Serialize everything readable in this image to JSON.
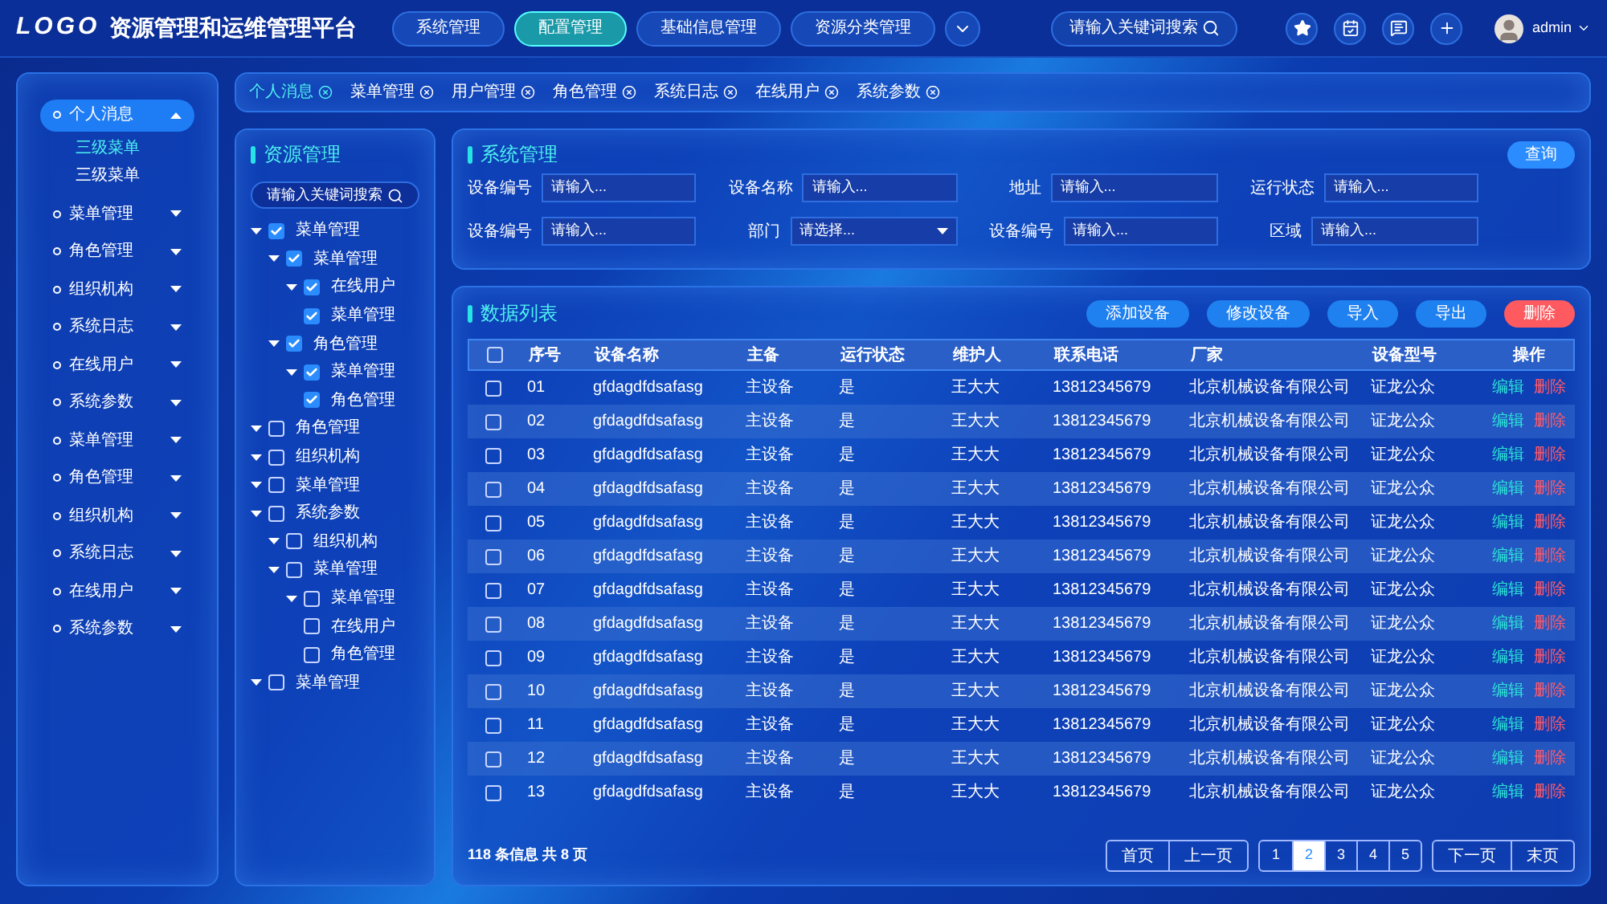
{
  "header": {
    "logo": "LOGO",
    "title": "资源管理和运维管理平台",
    "nav": [
      {
        "label": "系统管理",
        "selected": false
      },
      {
        "label": "配置管理",
        "selected": true
      },
      {
        "label": "基础信息管理",
        "selected": false
      },
      {
        "label": "资源分类管理",
        "selected": false
      }
    ],
    "search": {
      "placeholder": "请输入关键词搜索"
    },
    "user": {
      "name": "admin"
    }
  },
  "tabs": [
    {
      "label": "个人消息",
      "selected": true
    },
    {
      "label": "菜单管理",
      "selected": false
    },
    {
      "label": "用户管理",
      "selected": false
    },
    {
      "label": "角色管理",
      "selected": false
    },
    {
      "label": "系统日志",
      "selected": false
    },
    {
      "label": "在线用户",
      "selected": false
    },
    {
      "label": "系统参数",
      "selected": false
    }
  ],
  "sidebar": {
    "items": [
      {
        "label": "个人消息",
        "selected": true,
        "expanded": true,
        "children": [
          {
            "label": "三级菜单",
            "selected": true
          },
          {
            "label": "三级菜单",
            "selected": false
          }
        ]
      },
      {
        "label": "菜单管理",
        "selected": false,
        "expanded": false
      },
      {
        "label": "角色管理",
        "selected": false,
        "expanded": false
      },
      {
        "label": "组织机构",
        "selected": false,
        "expanded": false
      },
      {
        "label": "系统日志",
        "selected": false,
        "expanded": false
      },
      {
        "label": "在线用户",
        "selected": false,
        "expanded": false
      },
      {
        "label": "系统参数",
        "selected": false,
        "expanded": false
      },
      {
        "label": "菜单管理",
        "selected": false,
        "expanded": false
      },
      {
        "label": "角色管理",
        "selected": false,
        "expanded": false
      },
      {
        "label": "组织机构",
        "selected": false,
        "expanded": false
      },
      {
        "label": "系统日志",
        "selected": false,
        "expanded": false
      },
      {
        "label": "在线用户",
        "selected": false,
        "expanded": false
      },
      {
        "label": "系统参数",
        "selected": false,
        "expanded": false
      }
    ]
  },
  "tree": {
    "title": "资源管理",
    "search": {
      "placeholder": "请输入关键词搜索"
    },
    "nodes": [
      {
        "label": "菜单管理",
        "kind": "branch",
        "checked": true,
        "children": [
          {
            "label": "菜单管理",
            "kind": "branch",
            "checked": true,
            "children": [
              {
                "label": "在线用户",
                "kind": "branch",
                "checked": true
              },
              {
                "label": "菜单管理",
                "kind": "leaf",
                "checked": true
              }
            ]
          },
          {
            "label": "角色管理",
            "kind": "branch",
            "checked": true,
            "children": [
              {
                "label": "菜单管理",
                "kind": "branch",
                "checked": true
              },
              {
                "label": "角色管理",
                "kind": "leaf",
                "checked": true
              }
            ]
          }
        ]
      },
      {
        "label": "角色管理",
        "kind": "branch",
        "checked": false
      },
      {
        "label": "组织机构",
        "kind": "branch",
        "checked": false
      },
      {
        "label": "菜单管理",
        "kind": "branch",
        "checked": false
      },
      {
        "label": "系统参数",
        "kind": "branch",
        "checked": false,
        "children": [
          {
            "label": "组织机构",
            "kind": "branch",
            "checked": false
          },
          {
            "label": "菜单管理",
            "kind": "branch",
            "checked": false,
            "children": [
              {
                "label": "菜单管理",
                "kind": "branch",
                "checked": false
              },
              {
                "label": "在线用户",
                "kind": "leaf",
                "checked": false
              },
              {
                "label": "角色管理",
                "kind": "leaf",
                "checked": false
              }
            ]
          }
        ]
      },
      {
        "label": "菜单管理",
        "kind": "branch",
        "checked": false
      }
    ]
  },
  "filters": {
    "title": "系统管理",
    "query_button": "查询",
    "rows": [
      [
        {
          "label": "设备编号",
          "kind": "input",
          "placeholder": "请输入..."
        },
        {
          "label": "设备名称",
          "kind": "input",
          "placeholder": "请输入..."
        },
        {
          "label": "地址",
          "kind": "input",
          "placeholder": "请输入..."
        },
        {
          "label": "运行状态",
          "kind": "input",
          "placeholder": "请输入..."
        }
      ],
      [
        {
          "label": "设备编号",
          "kind": "input",
          "placeholder": "请输入..."
        },
        {
          "label": "部门",
          "kind": "select",
          "placeholder": "请选择..."
        },
        {
          "label": "设备编号",
          "kind": "input",
          "placeholder": "请输入..."
        },
        {
          "label": "区域",
          "kind": "input",
          "placeholder": "请输入..."
        }
      ]
    ]
  },
  "data_list": {
    "title": "数据列表",
    "buttons": [
      {
        "label": "添加设备",
        "kind": "primary"
      },
      {
        "label": "修改设备",
        "kind": "primary"
      },
      {
        "label": "导入",
        "kind": "primary"
      },
      {
        "label": "导出",
        "kind": "primary"
      },
      {
        "label": "删除",
        "kind": "danger"
      }
    ],
    "table": {
      "header_checked": false,
      "columns": [
        "序号",
        "设备名称",
        "主备",
        "运行状态",
        "维护人",
        "联系电话",
        "厂家",
        "设备型号",
        "操作"
      ],
      "rows": [
        {
          "checked": false,
          "cells": [
            "01",
            "gfdagdfdsafasg",
            "主设备",
            "是",
            "王大大",
            "13812345679",
            "北京机械设备有限公司",
            "证龙公众"
          ],
          "actions": [
            "编辑",
            "删除"
          ]
        },
        {
          "checked": false,
          "cells": [
            "02",
            "gfdagdfdsafasg",
            "主设备",
            "是",
            "王大大",
            "13812345679",
            "北京机械设备有限公司",
            "证龙公众"
          ],
          "actions": [
            "编辑",
            "删除"
          ]
        },
        {
          "checked": false,
          "cells": [
            "03",
            "gfdagdfdsafasg",
            "主设备",
            "是",
            "王大大",
            "13812345679",
            "北京机械设备有限公司",
            "证龙公众"
          ],
          "actions": [
            "编辑",
            "删除"
          ]
        },
        {
          "checked": false,
          "cells": [
            "04",
            "gfdagdfdsafasg",
            "主设备",
            "是",
            "王大大",
            "13812345679",
            "北京机械设备有限公司",
            "证龙公众"
          ],
          "actions": [
            "编辑",
            "删除"
          ]
        },
        {
          "checked": false,
          "cells": [
            "05",
            "gfdagdfdsafasg",
            "主设备",
            "是",
            "王大大",
            "13812345679",
            "北京机械设备有限公司",
            "证龙公众"
          ],
          "actions": [
            "编辑",
            "删除"
          ]
        },
        {
          "checked": false,
          "cells": [
            "06",
            "gfdagdfdsafasg",
            "主设备",
            "是",
            "王大大",
            "13812345679",
            "北京机械设备有限公司",
            "证龙公众"
          ],
          "actions": [
            "编辑",
            "删除"
          ]
        },
        {
          "checked": false,
          "cells": [
            "07",
            "gfdagdfdsafasg",
            "主设备",
            "是",
            "王大大",
            "13812345679",
            "北京机械设备有限公司",
            "证龙公众"
          ],
          "actions": [
            "编辑",
            "删除"
          ]
        },
        {
          "checked": false,
          "cells": [
            "08",
            "gfdagdfdsafasg",
            "主设备",
            "是",
            "王大大",
            "13812345679",
            "北京机械设备有限公司",
            "证龙公众"
          ],
          "actions": [
            "编辑",
            "删除"
          ]
        },
        {
          "checked": false,
          "cells": [
            "09",
            "gfdagdfdsafasg",
            "主设备",
            "是",
            "王大大",
            "13812345679",
            "北京机械设备有限公司",
            "证龙公众"
          ],
          "actions": [
            "编辑",
            "删除"
          ]
        },
        {
          "checked": false,
          "cells": [
            "10",
            "gfdagdfdsafasg",
            "主设备",
            "是",
            "王大大",
            "13812345679",
            "北京机械设备有限公司",
            "证龙公众"
          ],
          "actions": [
            "编辑",
            "删除"
          ]
        },
        {
          "checked": false,
          "cells": [
            "11",
            "gfdagdfdsafasg",
            "主设备",
            "是",
            "王大大",
            "13812345679",
            "北京机械设备有限公司",
            "证龙公众"
          ],
          "actions": [
            "编辑",
            "删除"
          ]
        },
        {
          "checked": false,
          "cells": [
            "12",
            "gfdagdfdsafasg",
            "主设备",
            "是",
            "王大大",
            "13812345679",
            "北京机械设备有限公司",
            "证龙公众"
          ],
          "actions": [
            "编辑",
            "删除"
          ]
        },
        {
          "checked": false,
          "cells": [
            "13",
            "gfdagdfdsafasg",
            "主设备",
            "是",
            "王大大",
            "13812345679",
            "北京机械设备有限公司",
            "证龙公众"
          ],
          "actions": [
            "编辑",
            "删除"
          ]
        }
      ]
    },
    "pagination": {
      "summary": "118 条信息 共 8 页",
      "first": "首页",
      "prev": "上一页",
      "pages": [
        {
          "label": "1",
          "selected": false
        },
        {
          "label": "2",
          "selected": true
        },
        {
          "label": "3",
          "selected": false
        },
        {
          "label": "4",
          "selected": false
        },
        {
          "label": "5",
          "selected": false
        }
      ],
      "next": "下一页",
      "last": "末页"
    }
  }
}
